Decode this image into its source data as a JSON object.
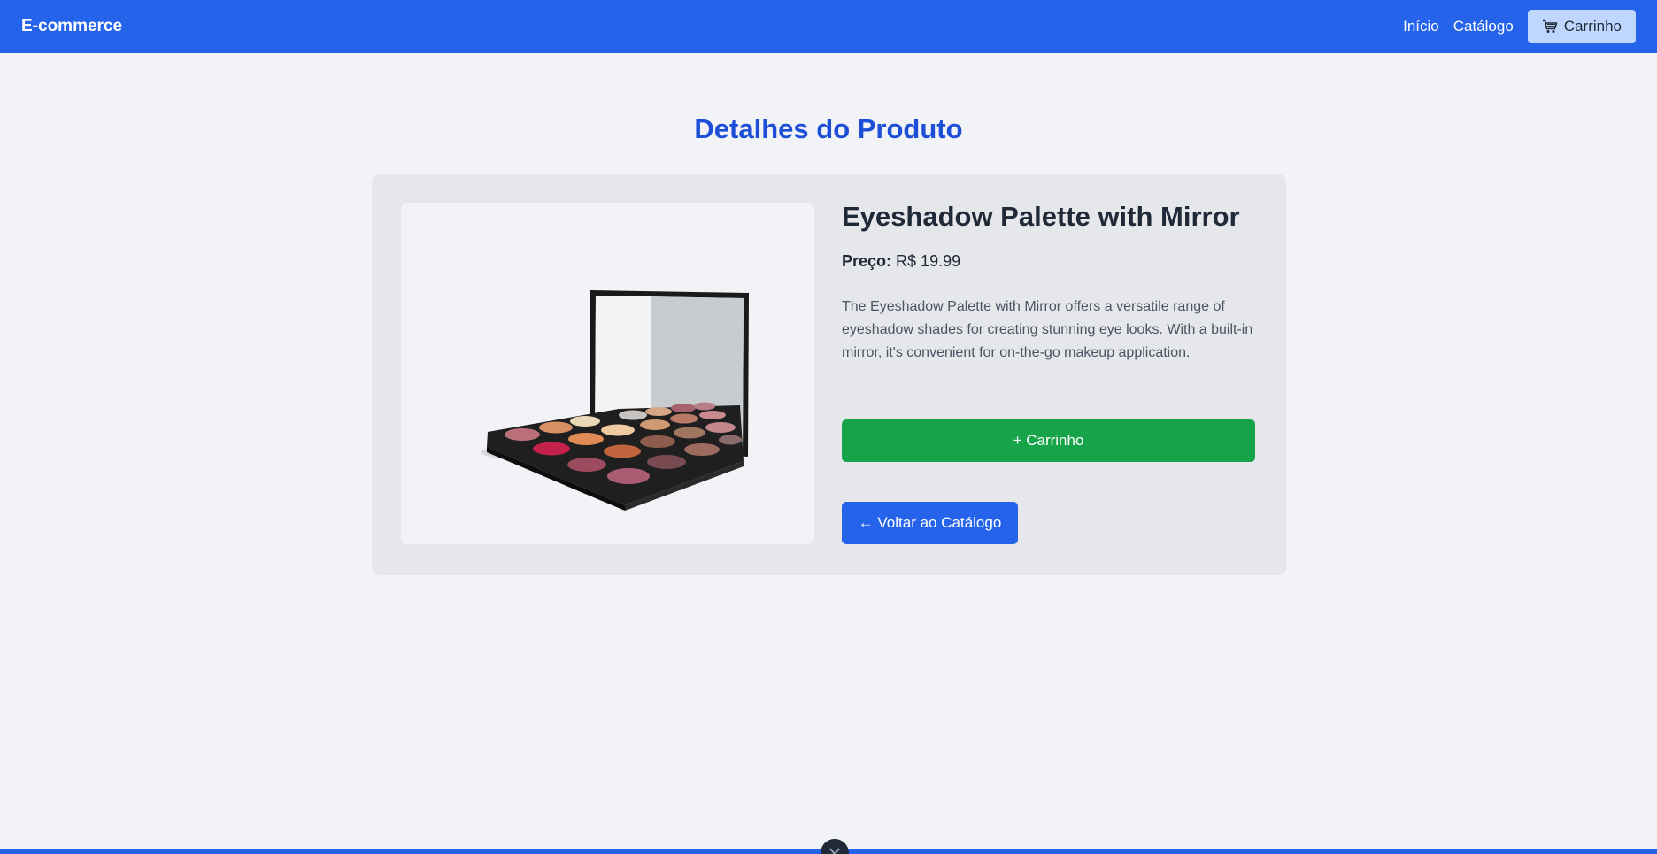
{
  "header": {
    "brand": "E-commerce",
    "nav": [
      {
        "label": "Início"
      },
      {
        "label": "Catálogo"
      }
    ],
    "cart_label": "Carrinho",
    "cart_icon": "cart-icon"
  },
  "page": {
    "title": "Detalhes do Produto"
  },
  "product": {
    "name": "Eyeshadow Palette with Mirror",
    "price_label": "Preço:",
    "price_value": "R$ 19.99",
    "description": "The Eyeshadow Palette with Mirror offers a versatile range of eyeshadow shades for creating stunning eye looks. With a built-in mirror, it's convenient for on-the-go makeup application.",
    "image_icon": "eyeshadow-palette-image",
    "add_to_cart_label": "+ Carrinho",
    "back_label": "← Voltar ao Catálogo"
  },
  "colors": {
    "primary": "#2563eb",
    "title": "#1d4ed8",
    "success": "#16a34a",
    "card": "#e5e7eb",
    "background": "#f2f3f6"
  },
  "footer": {
    "toggle_icon": "chevron-down-icon"
  }
}
